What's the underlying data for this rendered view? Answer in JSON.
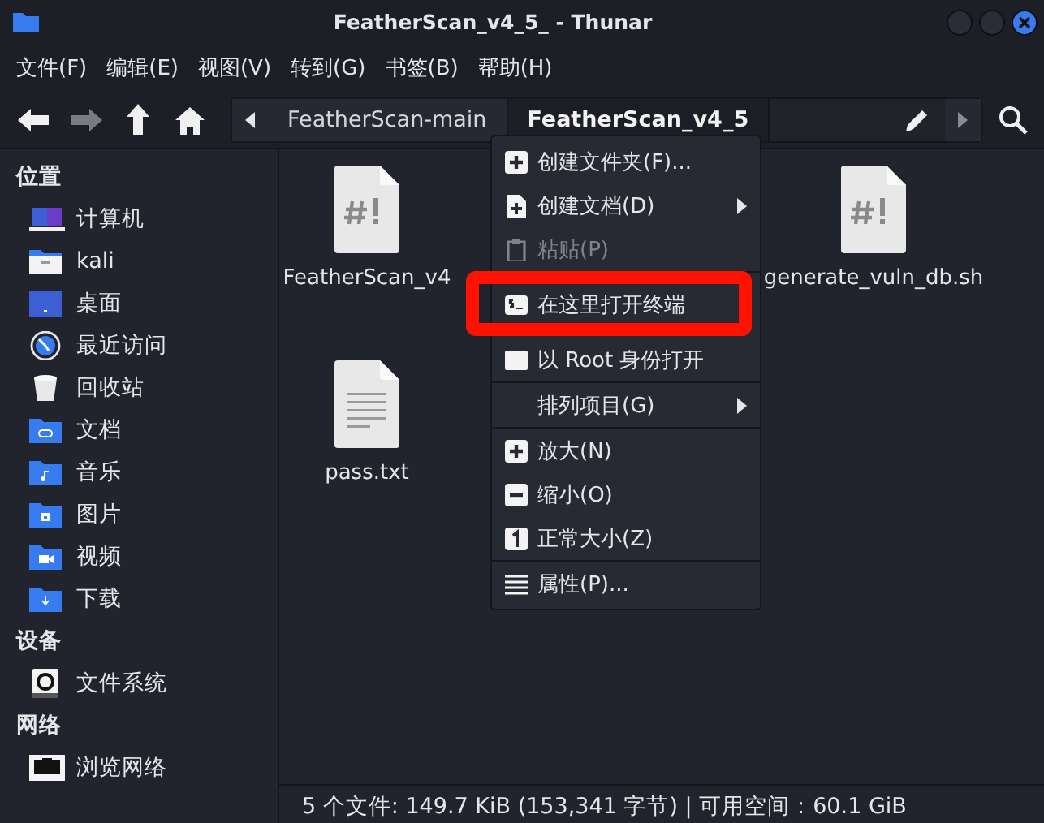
{
  "window": {
    "title": "FeatherScan_v4_5_ - Thunar"
  },
  "menubar": [
    "文件(F)",
    "编辑(E)",
    "视图(V)",
    "转到(G)",
    "书签(B)",
    "帮助(H)"
  ],
  "toolbar": {
    "back_disabled": false,
    "forward_disabled": true,
    "path": [
      {
        "label": "FeatherScan-main",
        "selected": false
      },
      {
        "label": "FeatherScan_v4_5",
        "selected": true
      }
    ]
  },
  "sidebar": [
    {
      "heading": "位置",
      "items": [
        {
          "label": "计算机",
          "kind": "computer"
        },
        {
          "label": "kali",
          "kind": "home"
        },
        {
          "label": "桌面",
          "kind": "desktop"
        },
        {
          "label": "最近访问",
          "kind": "recent"
        },
        {
          "label": "回收站",
          "kind": "trash"
        },
        {
          "label": "文档",
          "kind": "documents"
        },
        {
          "label": "音乐",
          "kind": "music"
        },
        {
          "label": "图片",
          "kind": "pictures"
        },
        {
          "label": "视频",
          "kind": "videos"
        },
        {
          "label": "下载",
          "kind": "downloads"
        }
      ]
    },
    {
      "heading": "设备",
      "items": [
        {
          "label": "文件系统",
          "kind": "drive"
        }
      ]
    },
    {
      "heading": "网络",
      "items": [
        {
          "label": "浏览网络",
          "kind": "network"
        }
      ]
    }
  ],
  "files": [
    {
      "name": "FeatherScan_v4",
      "kind": "script"
    },
    {
      "name": "generate_vuln_db.sh",
      "kind": "script"
    },
    {
      "name": "pass.txt",
      "kind": "text"
    }
  ],
  "context_menu": [
    {
      "label": "创建文件夹(F)...",
      "kind": "plus",
      "disabled": false,
      "submenu": false,
      "highlighted": false,
      "separator_after": false
    },
    {
      "label": "创建文档(D)",
      "kind": "plus-doc",
      "disabled": false,
      "submenu": true,
      "highlighted": false,
      "separator_after": false
    },
    {
      "label": "粘贴(P)",
      "kind": "clipboard",
      "disabled": true,
      "submenu": false,
      "highlighted": false,
      "separator_after": true
    },
    {
      "label": "在这里打开终端",
      "kind": "terminal",
      "disabled": false,
      "submenu": false,
      "highlighted": true,
      "separator_after": false
    },
    {
      "label": "以 Root 身份打开",
      "kind": "blank",
      "disabled": false,
      "submenu": false,
      "highlighted": false,
      "separator_after": true
    },
    {
      "label": "排列项目(G)",
      "kind": "none",
      "disabled": false,
      "submenu": true,
      "highlighted": false,
      "separator_after": true
    },
    {
      "label": "放大(N)",
      "kind": "plus",
      "disabled": false,
      "submenu": false,
      "highlighted": false,
      "separator_after": false
    },
    {
      "label": "缩小(O)",
      "kind": "minus",
      "disabled": false,
      "submenu": false,
      "highlighted": false,
      "separator_after": false
    },
    {
      "label": "正常大小(Z)",
      "kind": "one",
      "disabled": false,
      "submenu": false,
      "highlighted": false,
      "separator_after": true
    },
    {
      "label": "属性(P)...",
      "kind": "lines",
      "disabled": false,
      "submenu": false,
      "highlighted": false,
      "separator_after": false
    }
  ],
  "status_bar": "5 个文件: 149.7 KiB (153,341 字节) | 可用空间：60.1 GiB"
}
